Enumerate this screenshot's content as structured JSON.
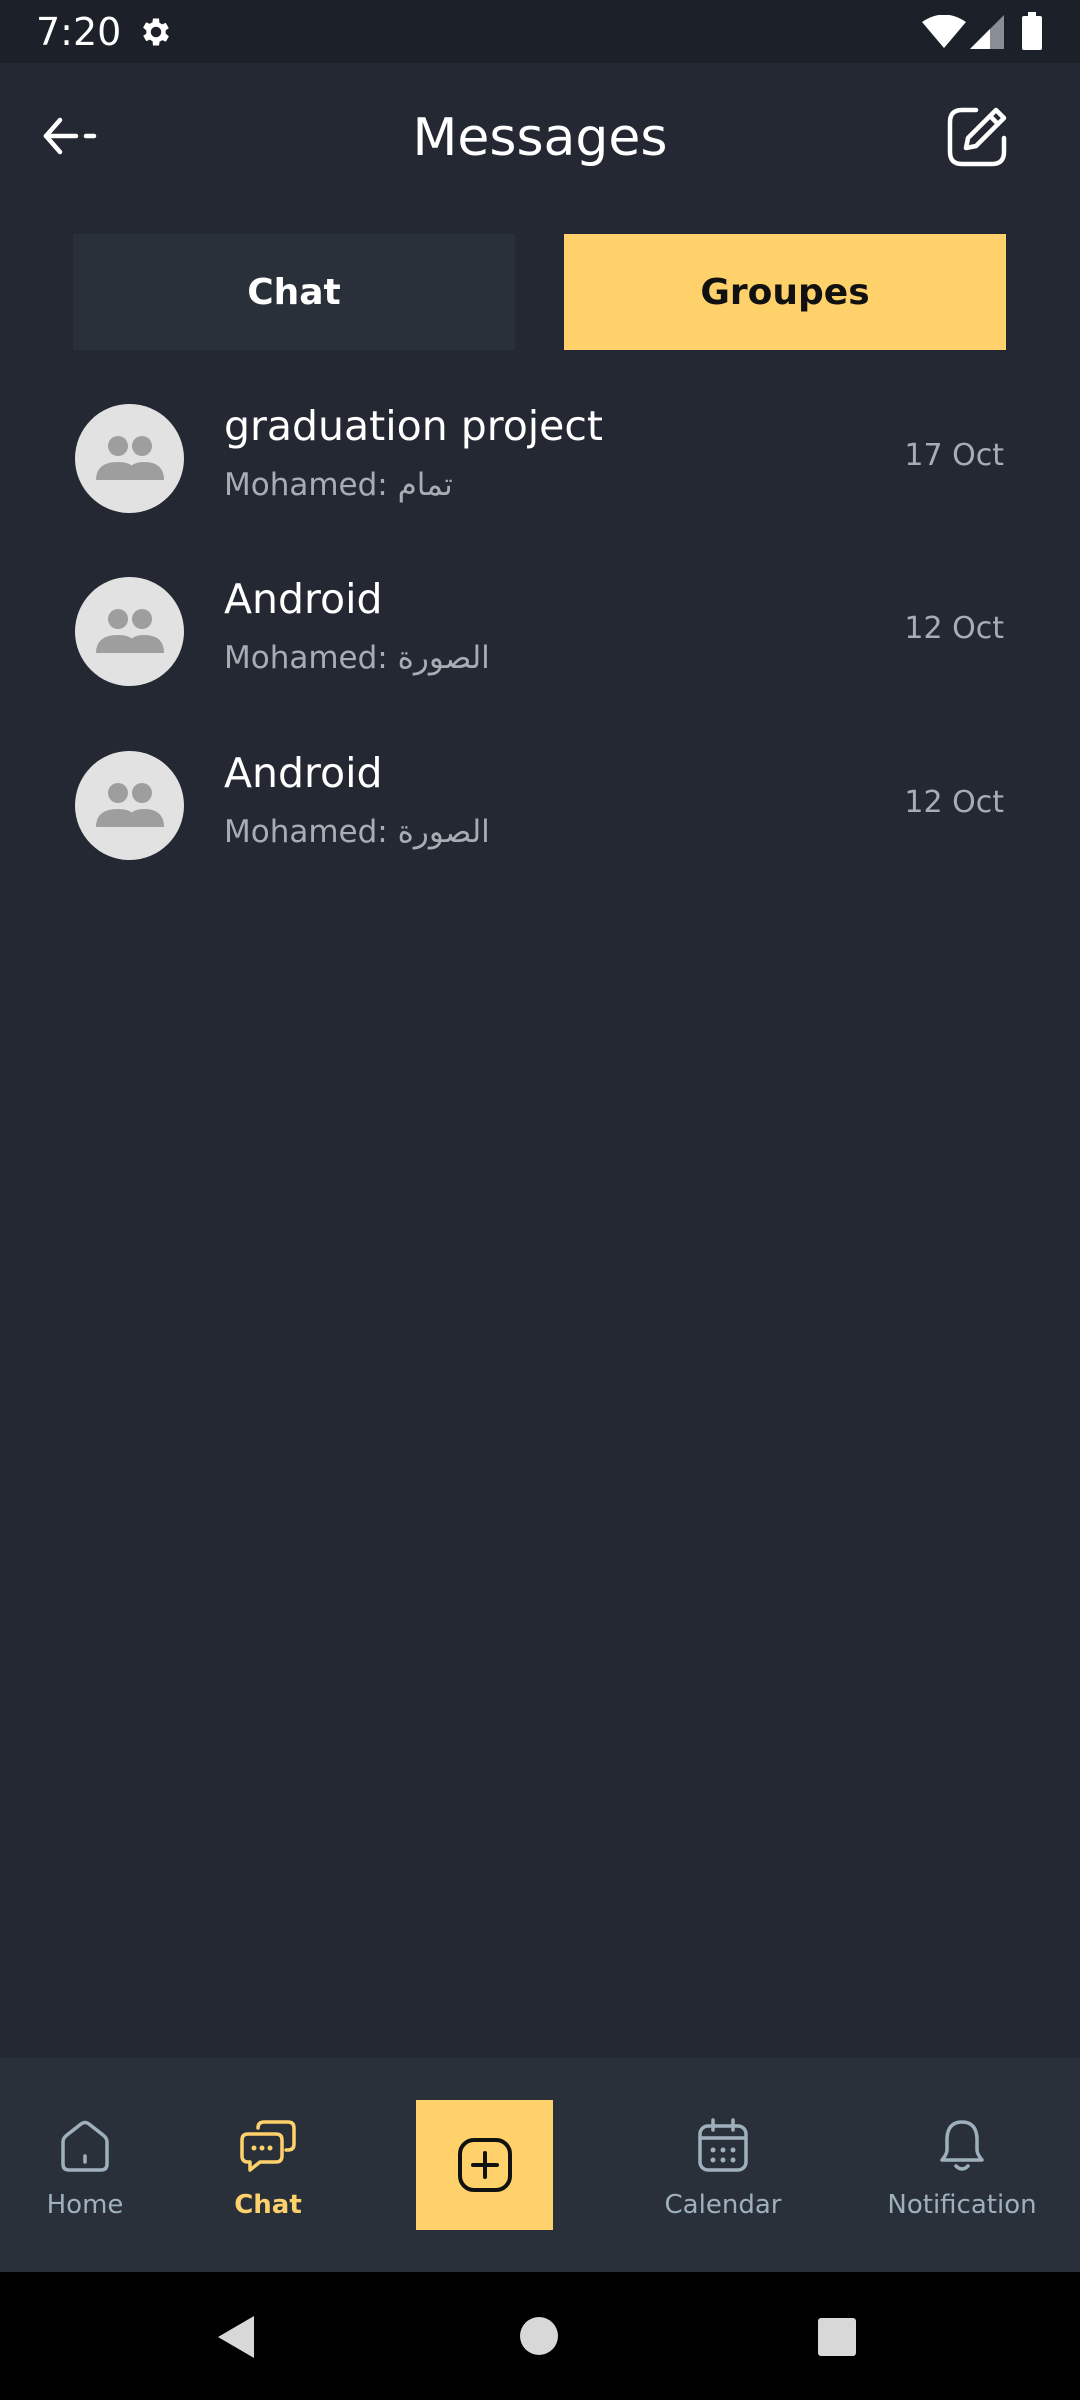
{
  "status_bar": {
    "time": "7:20",
    "icons": [
      "gear-icon",
      "wifi-icon",
      "signal-icon",
      "battery-icon"
    ]
  },
  "header": {
    "title": "Messages",
    "back_icon": "arrow-left-icon",
    "compose_icon": "edit-icon"
  },
  "tabs": [
    {
      "label": "Chat",
      "active": false
    },
    {
      "label": "Groupes",
      "active": true
    }
  ],
  "groups": [
    {
      "name": "graduation project",
      "preview": "Mohamed: تمام",
      "date": "17 Oct",
      "avatar_icon": "group-icon"
    },
    {
      "name": "Android",
      "preview": "Mohamed: الصورة",
      "date": "12 Oct",
      "avatar_icon": "group-icon"
    },
    {
      "name": "Android",
      "preview": "Mohamed: الصورة",
      "date": "12 Oct",
      "avatar_icon": "group-icon"
    }
  ],
  "bottom_nav": {
    "home": {
      "label": "Home",
      "icon": "home-icon"
    },
    "chat": {
      "label": "Chat",
      "icon": "chat-icon",
      "active": true
    },
    "add": {
      "icon": "plus-square-icon"
    },
    "calendar": {
      "label": "Calendar",
      "icon": "calendar-icon"
    },
    "notification": {
      "label": "Notification",
      "icon": "bell-icon"
    }
  },
  "colors": {
    "background": "#232833",
    "accent": "#ffd16b",
    "tab_inactive": "#293039",
    "muted_text": "#a9acb3",
    "nav_icon": "#9fb0bd"
  }
}
